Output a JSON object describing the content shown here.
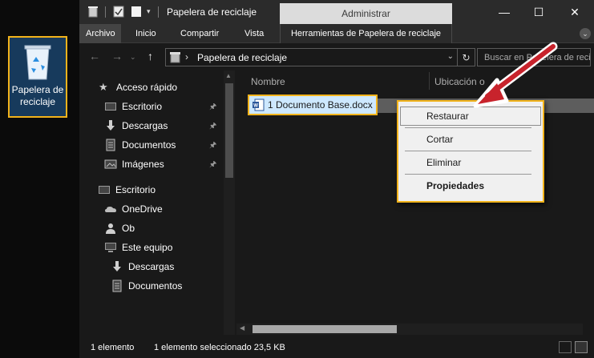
{
  "desktop": {
    "recycle_bin_label": "Papelera de reciclaje"
  },
  "window": {
    "title": "Papelera de reciclaje",
    "contextual_tab_group": "Administrar",
    "ribbon_tabs": [
      "Archivo",
      "Inicio",
      "Compartir",
      "Vista"
    ],
    "contextual_tab": "Herramientas de Papelera de reciclaje"
  },
  "address": {
    "path": "Papelera de reciclaje",
    "search_placeholder": "Buscar en Papelera de reciclaje"
  },
  "sidebar": {
    "items": [
      {
        "label": "Acceso rápido",
        "icon": "star-icon",
        "pinned": false
      },
      {
        "label": "Escritorio",
        "icon": "desktop-icon",
        "pinned": true
      },
      {
        "label": "Descargas",
        "icon": "download-arrow-icon",
        "pinned": true
      },
      {
        "label": "Documentos",
        "icon": "document-icon",
        "pinned": true
      },
      {
        "label": "Imágenes",
        "icon": "pictures-icon",
        "pinned": true
      },
      {
        "label": "Escritorio",
        "icon": "desktop-icon",
        "pinned": false
      },
      {
        "label": "OneDrive",
        "icon": "cloud-icon",
        "pinned": false
      },
      {
        "label": "Ob",
        "icon": "user-icon",
        "pinned": false
      },
      {
        "label": "Este equipo",
        "icon": "computer-icon",
        "pinned": false
      },
      {
        "label": "Descargas",
        "icon": "download-arrow-icon",
        "pinned": false
      },
      {
        "label": "Documentos",
        "icon": "document-icon",
        "pinned": false
      }
    ]
  },
  "columns": {
    "name": "Nombre",
    "location": "Ubicación o"
  },
  "files": [
    {
      "name": "1 Documento Base.docx",
      "icon": "word-document-icon",
      "selected": true
    }
  ],
  "context_menu": {
    "items": [
      "Restaurar",
      "Cortar",
      "Eliminar",
      "Propiedades"
    ],
    "default_item": "Propiedades",
    "hovered_item": "Restaurar"
  },
  "status": {
    "count": "1 elemento",
    "selection": "1 elemento seleccionado  23,5 KB"
  },
  "colors": {
    "highlight_border": "#f2b31b",
    "selection_fill": "#cde8ff",
    "annotation_arrow": "#c8232c"
  }
}
